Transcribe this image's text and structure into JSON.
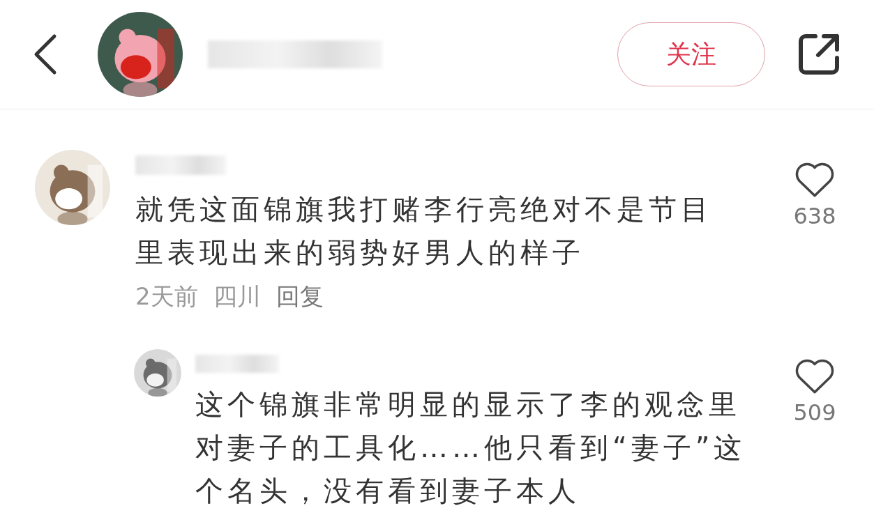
{
  "header": {
    "follow_button": "关注"
  },
  "comments": [
    {
      "text": "就凭这面锦旗我打赌李行亮绝对不是节目里表现出来的弱势好男人的样子",
      "time": "2天前",
      "location": "四川",
      "reply": "回复",
      "likes": "638",
      "kind": "top"
    },
    {
      "text": "这个锦旗非常明显的显示了李的观念里对妻子的工具化……他只看到“妻子”这个名头，没有看到妻子本人",
      "likes": "509",
      "kind": "reply"
    }
  ]
}
